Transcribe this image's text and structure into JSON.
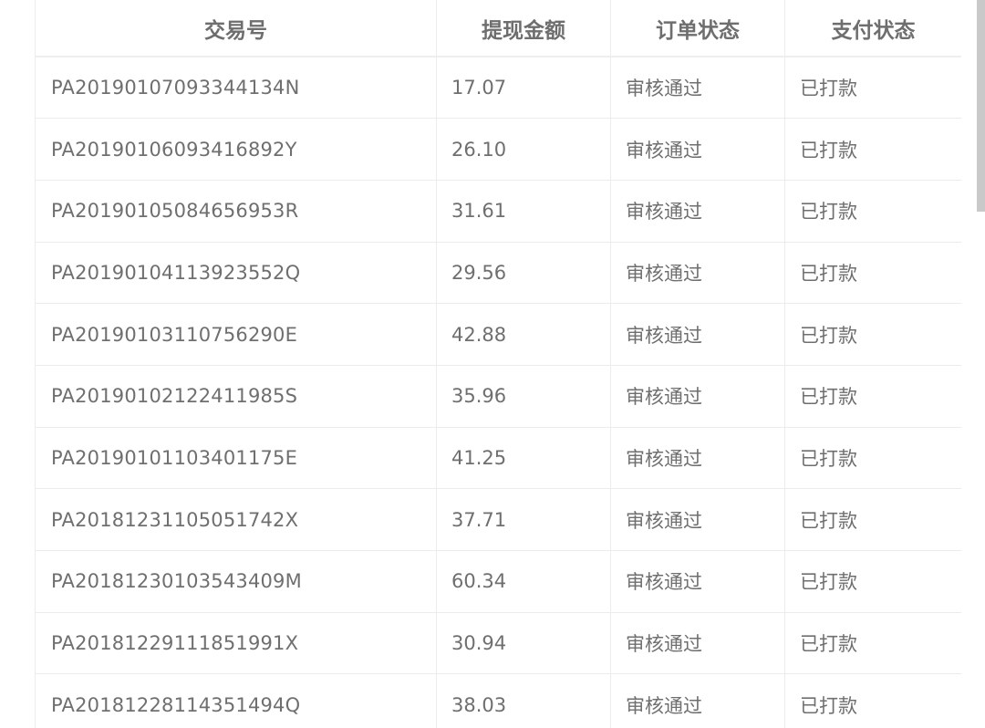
{
  "table": {
    "columns": [
      "交易号",
      "提现金额",
      "订单状态",
      "支付状态"
    ],
    "rows": [
      {
        "txn": "PA20190107093344134N",
        "amount": "17.07",
        "order_status": "审核通过",
        "pay_status": "已打款"
      },
      {
        "txn": "PA20190106093416892Y",
        "amount": "26.10",
        "order_status": "审核通过",
        "pay_status": "已打款"
      },
      {
        "txn": "PA20190105084656953R",
        "amount": "31.61",
        "order_status": "审核通过",
        "pay_status": "已打款"
      },
      {
        "txn": "PA20190104113923552Q",
        "amount": "29.56",
        "order_status": "审核通过",
        "pay_status": "已打款"
      },
      {
        "txn": "PA20190103110756290E",
        "amount": "42.88",
        "order_status": "审核通过",
        "pay_status": "已打款"
      },
      {
        "txn": "PA20190102122411985S",
        "amount": "35.96",
        "order_status": "审核通过",
        "pay_status": "已打款"
      },
      {
        "txn": "PA20190101103401175E",
        "amount": "41.25",
        "order_status": "审核通过",
        "pay_status": "已打款"
      },
      {
        "txn": "PA20181231105051742X",
        "amount": "37.71",
        "order_status": "审核通过",
        "pay_status": "已打款"
      },
      {
        "txn": "PA20181230103543409M",
        "amount": "60.34",
        "order_status": "审核通过",
        "pay_status": "已打款"
      },
      {
        "txn": "PA20181229111851991X",
        "amount": "30.94",
        "order_status": "审核通过",
        "pay_status": "已打款"
      },
      {
        "txn": "PA20181228114351494Q",
        "amount": "38.03",
        "order_status": "审核通过",
        "pay_status": "已打款"
      }
    ]
  }
}
